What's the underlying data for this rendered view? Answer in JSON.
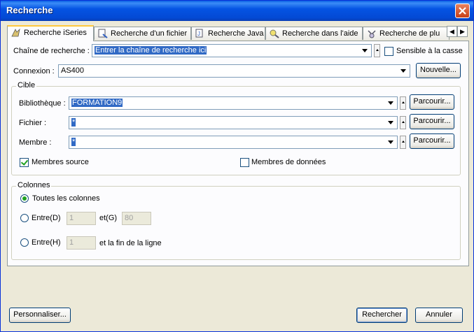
{
  "window": {
    "title": "Recherche"
  },
  "tabs": [
    {
      "label": "Recherche iSeries"
    },
    {
      "label": "Recherche d'un fichier"
    },
    {
      "label": "Recherche Java"
    },
    {
      "label": "Recherche dans l'aide"
    },
    {
      "label": "Recherche de plu"
    }
  ],
  "search": {
    "label": "Chaîne de recherche :",
    "value": "Entrer la chaîne de recherche ici",
    "case_label": "Sensible à la casse",
    "case_checked": false
  },
  "connection": {
    "label": "Connexion :",
    "value": "AS400",
    "new_button": "Nouvelle..."
  },
  "target": {
    "legend": "Cible",
    "library_label": "Bibliothèque :",
    "library_value": "FORMATION9",
    "file_label": "Fichier :",
    "file_value": "*",
    "member_label": "Membre :",
    "member_value": "*",
    "browse_label": "Parcourir...",
    "source_members_label": "Membres source",
    "source_members_checked": true,
    "data_members_label": "Membres de données",
    "data_members_checked": false
  },
  "columns": {
    "legend": "Colonnes",
    "all_label": "Toutes les colonnes",
    "between_label": "Entre(D)",
    "between_from": "1",
    "and_label": "et(G)",
    "between_to": "80",
    "between_end_label": "Entre(H)",
    "between_end_from": "1",
    "end_label": "et la fin de la ligne"
  },
  "footer": {
    "customize_button": "Personnaliser...",
    "search_button": "Rechercher",
    "cancel_button": "Annuler"
  }
}
